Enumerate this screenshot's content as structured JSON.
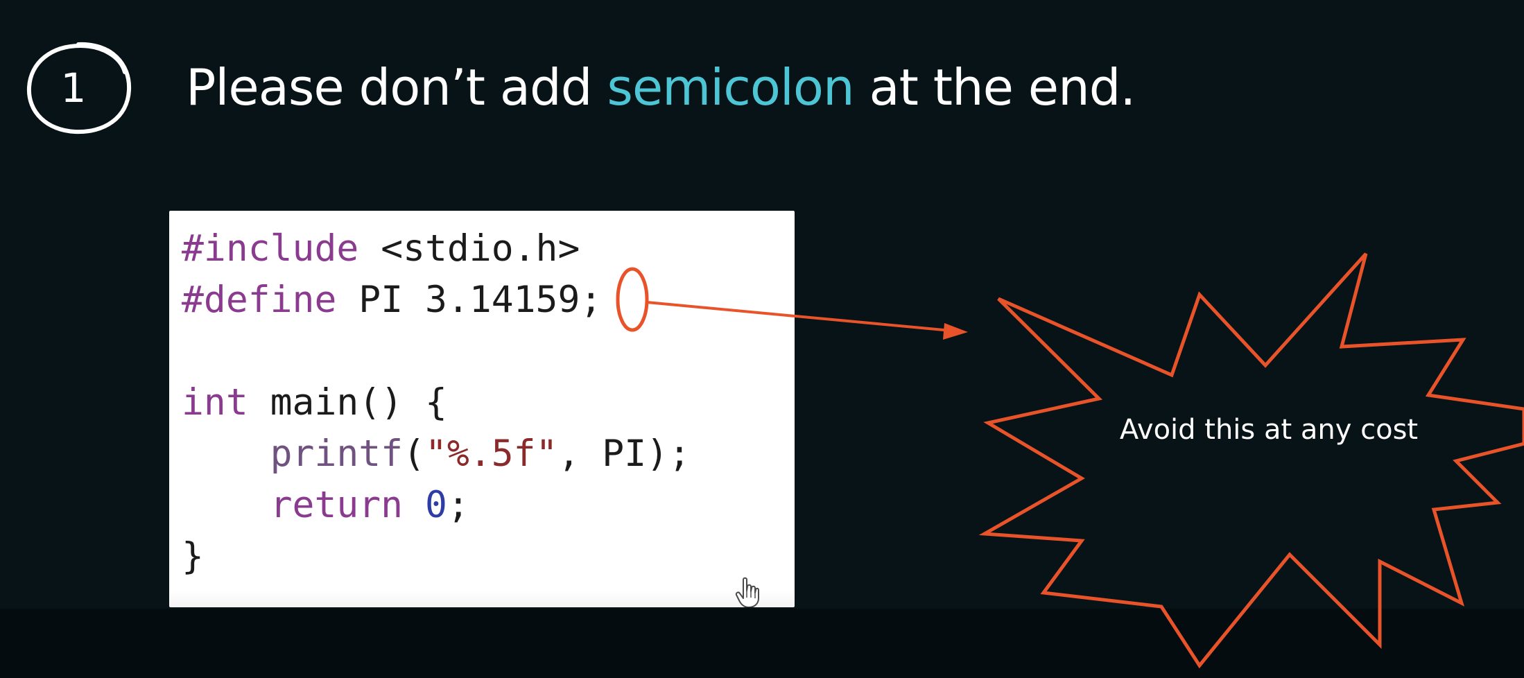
{
  "slide": {
    "step_number": "1",
    "heading": {
      "prefix": "Please don’t add ",
      "highlight": "semicolon",
      "suffix": " at the end."
    },
    "accent_color": "#4ec5d4",
    "warning_color": "#e8532a",
    "background_color": "#071317"
  },
  "code": {
    "lines": [
      "#include <stdio.h>",
      "#define PI 3.14159;",
      "",
      "int main() {",
      "    printf(\"%.5f\", PI);",
      "    return 0;",
      "}"
    ]
  },
  "callout": {
    "text": "Avoid this at any cost",
    "icons": [
      "number-circle-icon",
      "starburst-icon",
      "hand-pointer-icon",
      "arrow-icon"
    ]
  }
}
